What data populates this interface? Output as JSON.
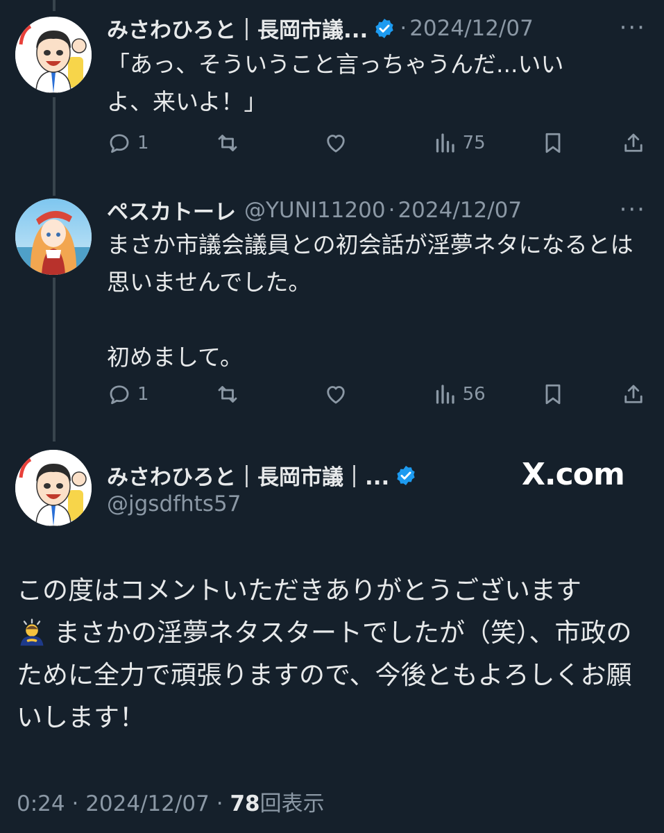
{
  "tweet1": {
    "name": "みさわひろと｜長岡市議...",
    "date": "2024/12/07",
    "separator": "·",
    "text": "「あっ、そういうこと言っちゃうんだ...いいよ、来いよ！」",
    "replies": "1",
    "views": "75",
    "more": "···"
  },
  "tweet2": {
    "name": "ペスカトーレ",
    "handle": "@YUNI11200",
    "separator": "·",
    "date": "2024/12/07",
    "text": "まさか市議会議員との初会話が淫夢ネタになるとは思いませんでした。\n\n初めまして。",
    "replies": "1",
    "views": "56",
    "more": "···"
  },
  "main_tweet": {
    "name": "みさわひろと｜長岡市議｜...",
    "handle": "@jgsdfhts57",
    "watermark": "X.com",
    "text_part1": "この度はコメントいただきありがとうございます",
    "text_part2": "まさかの淫夢ネタスタートでしたが（笑）、市政のために全力で頑張りますので、今後ともよろしくお願いします！",
    "time": "0:24",
    "date": "2024/12/07",
    "separator": "·",
    "view_count": "78",
    "view_label": "回表示"
  },
  "colors": {
    "background": "#15202b",
    "text": "#e7e9ea",
    "muted": "#8b98a5",
    "verified": "#1d9bf0",
    "thread_line": "#38444d"
  },
  "icons": [
    "verified-badge-icon",
    "reply-icon",
    "retweet-icon",
    "like-icon",
    "views-icon",
    "bookmark-icon",
    "share-icon",
    "more-icon",
    "bowing-emoji"
  ]
}
